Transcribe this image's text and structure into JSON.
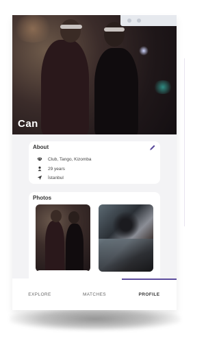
{
  "profile": {
    "name": "Can"
  },
  "about": {
    "title": "About",
    "rows": [
      {
        "icon": "mask-icon",
        "text": "Club, Tango, Kizomba"
      },
      {
        "icon": "person-icon",
        "text": "29 years"
      },
      {
        "icon": "location-arrow-icon",
        "text": "İstanbul"
      }
    ]
  },
  "photos": {
    "title": "Photos"
  },
  "nav": {
    "tabs": [
      {
        "label": "EXPLORE"
      },
      {
        "label": "MATCHES"
      },
      {
        "label": "PROFILE"
      }
    ],
    "active_index": 2
  },
  "colors": {
    "accent": "#5b4a9c",
    "card_background": "#ffffff",
    "screen_background": "#f3f3f5"
  }
}
